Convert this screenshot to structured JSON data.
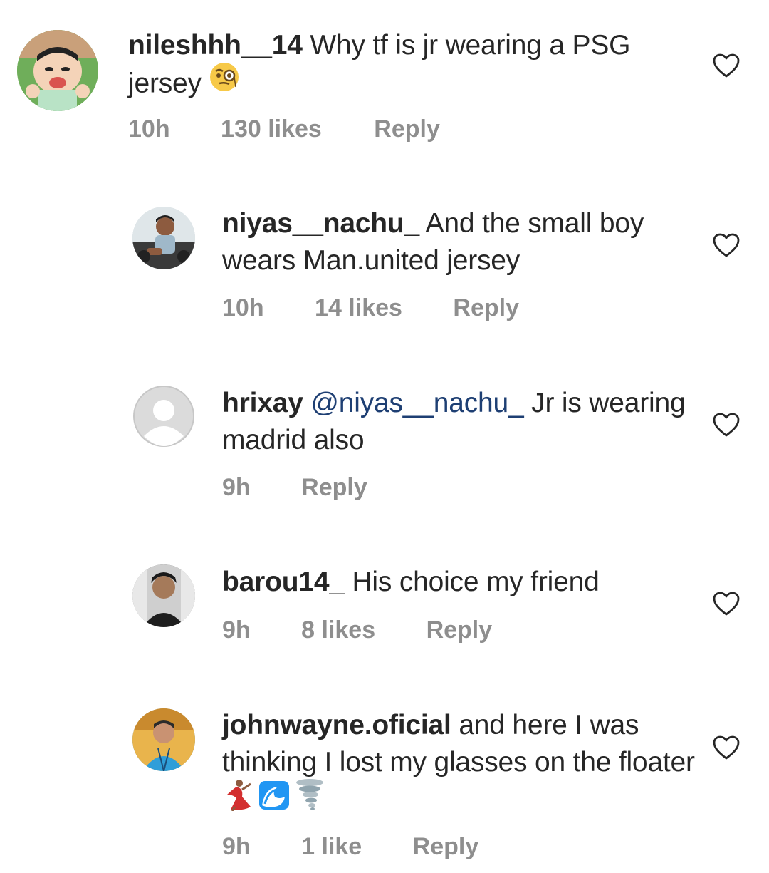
{
  "comments": [
    {
      "username": "nileshhh__14",
      "text": "Why tf is jr wearing a PSG jersey",
      "time": "10h",
      "likes": "130 likes",
      "reply": "Reply",
      "emoji": "face-with-monocle-icon"
    },
    {
      "username": "niyas__nachu_",
      "text": "And the small boy wears Man.united jersey",
      "time": "10h",
      "likes": "14 likes",
      "reply": "Reply"
    },
    {
      "username": "hrixay",
      "mention": "@niyas__nachu_",
      "text": "Jr is wearing madrid also",
      "time": "9h",
      "reply": "Reply"
    },
    {
      "username": "barou14_",
      "text": "His choice my friend",
      "time": "9h",
      "likes": "8 likes",
      "reply": "Reply"
    },
    {
      "username": "johnwayne.oficial",
      "text": "and here I was thinking I lost my glasses on the floater",
      "time": "9h",
      "likes": "1 like",
      "reply": "Reply",
      "emojis": [
        "dancer-icon",
        "water-wave-icon",
        "tornado-icon"
      ]
    }
  ],
  "colors": {
    "text": "#262626",
    "meta": "#8e8e8e",
    "mention": "#1e3f73",
    "heart_stroke": "#262626"
  }
}
